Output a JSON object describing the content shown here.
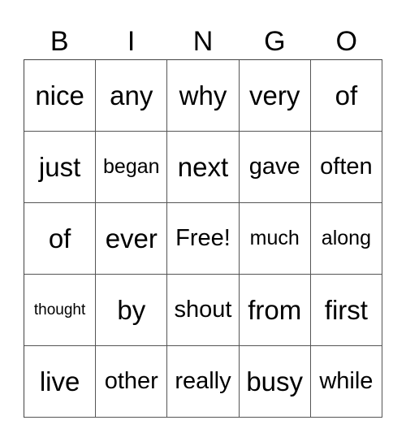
{
  "header": [
    "B",
    "I",
    "N",
    "G",
    "O"
  ],
  "cells": [
    [
      "nice",
      "any",
      "why",
      "very",
      "of"
    ],
    [
      "just",
      "began",
      "next",
      "gave",
      "often"
    ],
    [
      "of",
      "ever",
      "Free!",
      "much",
      "along"
    ],
    [
      "thought",
      "by",
      "shout",
      "from",
      "first"
    ],
    [
      "live",
      "other",
      "really",
      "busy",
      "while"
    ]
  ]
}
